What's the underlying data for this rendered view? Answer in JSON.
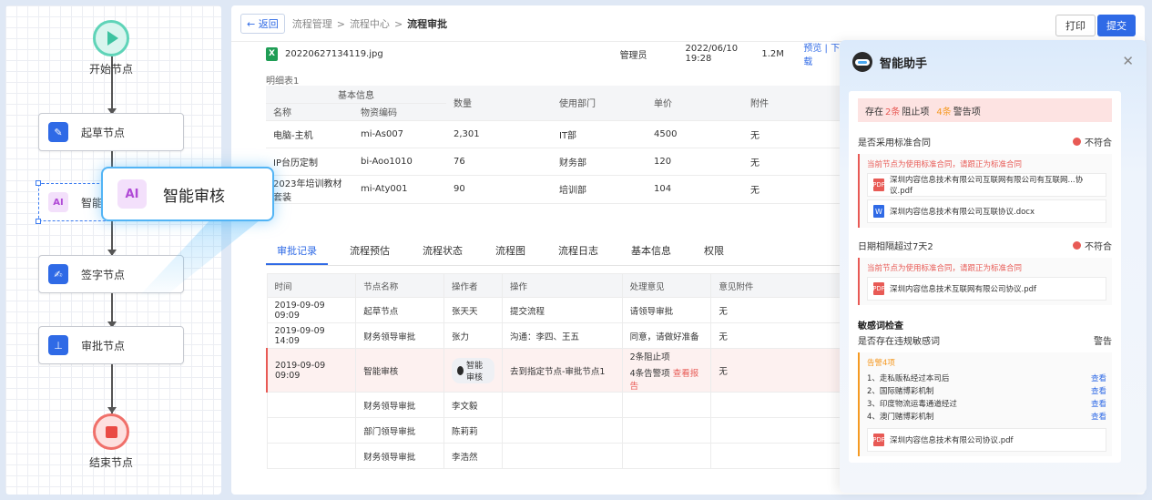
{
  "flow": {
    "start_label": "开始节点",
    "end_label": "结束节点",
    "nodes": [
      {
        "label": "起草节点",
        "icon": "document-edit-icon"
      },
      {
        "label": "智能",
        "icon": "ai-icon"
      },
      {
        "label": "签字节点",
        "icon": "pen-icon"
      },
      {
        "label": "审批节点",
        "icon": "stamp-icon"
      }
    ],
    "callout_icon": "AI",
    "callout_label": "智能审核"
  },
  "topbar": {
    "back_label": "← 返回",
    "breadcrumb": [
      "流程管理",
      "流程中心",
      "流程审批"
    ],
    "print_label": "打印",
    "submit_label": "提交"
  },
  "attachment": {
    "file_name": "20220627134119.jpg",
    "uploader": "管理员",
    "time": "2022/06/10 19:28",
    "size": "1.2M",
    "actions": "预览 | 下载"
  },
  "detail": {
    "label": "明细表1",
    "group_header": "基本信息",
    "columns": [
      "名称",
      "物资编码",
      "数量",
      "使用部门",
      "单价",
      "附件"
    ],
    "rows": [
      [
        "电脑-主机",
        "mi-As007",
        "2,301",
        "IT部",
        "4500",
        "无"
      ],
      [
        "IP台历定制",
        "bi-Aoo1010",
        "76",
        "财务部",
        "120",
        "无"
      ],
      [
        "2023年培训教材套装",
        "mi-Aty001",
        "90",
        "培训部",
        "104",
        "无"
      ]
    ]
  },
  "tabs": [
    "审批记录",
    "流程预估",
    "流程状态",
    "流程图",
    "流程日志",
    "基本信息",
    "权限"
  ],
  "records": {
    "columns": [
      "时间",
      "节点名称",
      "操作者",
      "操作",
      "处理意见",
      "意见附件"
    ],
    "rows": [
      {
        "time": "2019-09-09  09:09",
        "node": "起草节点",
        "operator": "张天天",
        "action": "提交流程",
        "opinion": "请领导审批",
        "attach": "无"
      },
      {
        "time": "2019-09-09  14:09",
        "node": "财务领导审批",
        "operator": "张力",
        "action": "沟通：李四、王五",
        "opinion": "同意，请做好准备",
        "attach": "无"
      },
      {
        "time": "2019-09-09  09:09",
        "node": "智能审核",
        "operator": "智能审核",
        "action": "去到指定节点-审批节点1",
        "opinion_line1": "2条阻止项",
        "opinion_line2": "4条告警项",
        "report_link": "查看报告",
        "attach": "无"
      },
      {
        "time": "",
        "node": "财务领导审批",
        "operator": "李文毅",
        "action": "",
        "opinion": "",
        "attach": ""
      },
      {
        "time": "",
        "node": "部门领导审批",
        "operator": "陈莉莉",
        "action": "",
        "opinion": "",
        "attach": ""
      },
      {
        "time": "",
        "node": "财务领导审批",
        "operator": "李浩然",
        "action": "",
        "opinion": "",
        "attach": ""
      }
    ]
  },
  "assistant": {
    "title": "智能助手",
    "summary_prefix": "存在",
    "block_count": "2条",
    "block_label": "阻止项",
    "warn_count": "4条",
    "warn_label": "警告项",
    "check1": {
      "title": "是否采用标准合同",
      "status": "不符合",
      "message": "当前节点为使用标准合同，请跟正为标准合同",
      "files": [
        "深圳内容信息技术有限公司互联网有限公司有互联网...协议.pdf",
        "深圳内容信息技术有限公司互联协议.docx"
      ]
    },
    "check2": {
      "title": "日期相隔超过7天2",
      "status": "不符合",
      "message": "当前节点为使用标准合同，请跟正为标准合同",
      "files": [
        "深圳内容信息技术互联网有限公司协议.pdf"
      ]
    },
    "sensitive": {
      "title": "敏感词检查",
      "question": "是否存在违规敏感词",
      "status": "警告",
      "warn_count": "告警4项",
      "view_label": "查看",
      "items": [
        "1、走私贩私经过本司后",
        "2、国际赌博彩机制",
        "3、印度物流运毒通道经过",
        "4、澳门赌博彩机制"
      ],
      "file": "深圳内容信息技术有限公司协议.pdf"
    }
  }
}
